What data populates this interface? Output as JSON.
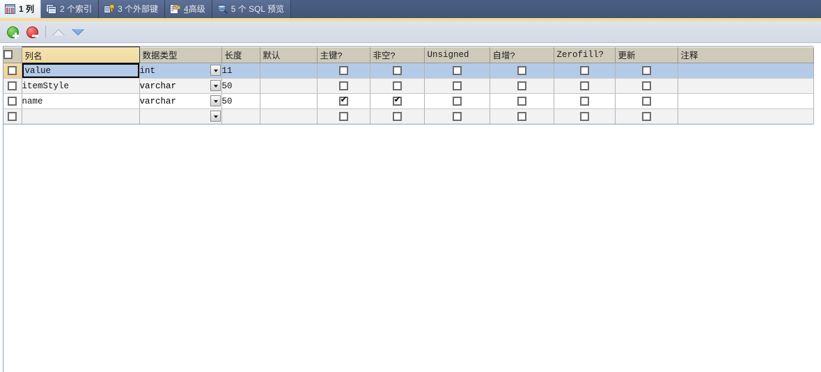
{
  "tabs": [
    {
      "label": "1 列",
      "icon": "table-grid-icon",
      "active": true,
      "accel": ""
    },
    {
      "label": "2 个索引",
      "icon": "index-icon",
      "active": false,
      "accel": ""
    },
    {
      "label": "3 个外部键",
      "icon": "foreign-key-icon",
      "active": false,
      "accel": ""
    },
    {
      "label": "4高级",
      "icon": "advanced-note-icon",
      "active": false,
      "accel": "4"
    },
    {
      "label": "5 个 SQL 预览",
      "icon": "sql-preview-icon",
      "active": false,
      "accel": ""
    }
  ],
  "toolbar": {
    "add_label": "添加栏位",
    "delete_label": "删除栏位",
    "move_up_label": "上移",
    "move_down_label": "下移"
  },
  "grid": {
    "columns": [
      {
        "key": "rowcheck",
        "label": "",
        "width": 26
      },
      {
        "key": "name",
        "label": "列名",
        "width": 169,
        "highlight": true
      },
      {
        "key": "type",
        "label": "数据类型",
        "width": 118
      },
      {
        "key": "length",
        "label": "长度",
        "width": 55
      },
      {
        "key": "default",
        "label": "默认",
        "width": 82
      },
      {
        "key": "pk",
        "label": "主键?",
        "width": 76
      },
      {
        "key": "notnull",
        "label": "非空?",
        "width": 78
      },
      {
        "key": "unsigned",
        "label": "Unsigned",
        "width": 94
      },
      {
        "key": "autoinc",
        "label": "自增?",
        "width": 92
      },
      {
        "key": "zerofill",
        "label": "Zerofill?",
        "width": 88
      },
      {
        "key": "update",
        "label": "更新",
        "width": 90
      },
      {
        "key": "comment",
        "label": "注释",
        "width": 195
      }
    ],
    "rows": [
      {
        "state": "selected",
        "rowcheck": false,
        "name": "value",
        "name_focused": true,
        "type": "int",
        "length": "11",
        "default": "",
        "pk": false,
        "notnull": false,
        "unsigned": false,
        "autoinc": false,
        "zerofill": false,
        "update": false,
        "comment": ""
      },
      {
        "state": "gray",
        "rowcheck": false,
        "name": "itemStyle",
        "name_focused": false,
        "type": "varchar",
        "length": "50",
        "default": "",
        "pk": false,
        "notnull": false,
        "unsigned": false,
        "autoinc": false,
        "zerofill": false,
        "update": false,
        "comment": ""
      },
      {
        "state": "white",
        "rowcheck": false,
        "name": "name",
        "name_focused": false,
        "type": "varchar",
        "length": "50",
        "default": "",
        "pk": true,
        "notnull": true,
        "unsigned": false,
        "autoinc": false,
        "zerofill": false,
        "update": false,
        "comment": ""
      },
      {
        "state": "gray",
        "rowcheck": false,
        "name": "",
        "name_focused": false,
        "type": "",
        "length": "",
        "default": "",
        "pk": false,
        "notnull": false,
        "unsigned": false,
        "autoinc": false,
        "zerofill": false,
        "update": false,
        "comment": ""
      }
    ]
  },
  "colors": {
    "tabbar_bg": "#465b81",
    "gold_strip": "#f4d98f",
    "toolbar_bg": "#d8dee8",
    "header_bg": "#cfcbbb",
    "header_highlight": "#f1dca4",
    "row_selected": "#b4cbe8",
    "row_alt": "#f2f2f2",
    "grid_border": "#8fa0bb",
    "add_button": "#57b93d",
    "delete_button": "#e04b4b",
    "down_arrow": "#5b8fd6"
  }
}
